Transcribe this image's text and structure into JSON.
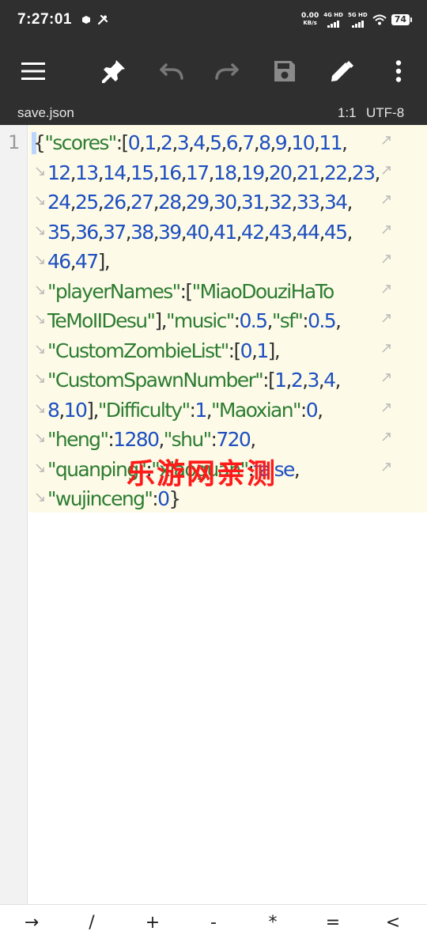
{
  "status": {
    "time": "7:27:01",
    "net_speed_value": "0.00",
    "net_speed_unit": "KB/s",
    "sim1_label": "4G HD",
    "sim2_label": "5G HD",
    "battery": "74"
  },
  "toolbar": {
    "icons": [
      "menu-icon",
      "pin-icon",
      "undo-icon",
      "redo-icon",
      "save-icon",
      "edit-icon",
      "more-icon"
    ]
  },
  "info": {
    "filename": "save.json",
    "cursor_position": "1:1",
    "encoding": "UTF-8"
  },
  "editor": {
    "line_number": "1",
    "lines": [
      [
        {
          "t": "{",
          "c": "p"
        },
        {
          "t": "\"scores\"",
          "c": "k"
        },
        {
          "t": ":[",
          "c": "p"
        },
        {
          "t": "0",
          "c": "n"
        },
        {
          "t": ",",
          "c": "p"
        },
        {
          "t": "1",
          "c": "n"
        },
        {
          "t": ",",
          "c": "p"
        },
        {
          "t": "2",
          "c": "n"
        },
        {
          "t": ",",
          "c": "p"
        },
        {
          "t": "3",
          "c": "n"
        },
        {
          "t": ",",
          "c": "p"
        },
        {
          "t": "4",
          "c": "n"
        },
        {
          "t": ",",
          "c": "p"
        },
        {
          "t": "5",
          "c": "n"
        },
        {
          "t": ",",
          "c": "p"
        },
        {
          "t": "6",
          "c": "n"
        },
        {
          "t": ",",
          "c": "p"
        },
        {
          "t": "7",
          "c": "n"
        },
        {
          "t": ",",
          "c": "p"
        },
        {
          "t": "8",
          "c": "n"
        },
        {
          "t": ",",
          "c": "p"
        },
        {
          "t": "9",
          "c": "n"
        },
        {
          "t": ",",
          "c": "p"
        },
        {
          "t": "10",
          "c": "n"
        },
        {
          "t": ",",
          "c": "p"
        },
        {
          "t": "11",
          "c": "n"
        },
        {
          "t": ",",
          "c": "p"
        }
      ],
      [
        {
          "t": "12",
          "c": "n"
        },
        {
          "t": ",",
          "c": "p"
        },
        {
          "t": "13",
          "c": "n"
        },
        {
          "t": ",",
          "c": "p"
        },
        {
          "t": "14",
          "c": "n"
        },
        {
          "t": ",",
          "c": "p"
        },
        {
          "t": "15",
          "c": "n"
        },
        {
          "t": ",",
          "c": "p"
        },
        {
          "t": "16",
          "c": "n"
        },
        {
          "t": ",",
          "c": "p"
        },
        {
          "t": "17",
          "c": "n"
        },
        {
          "t": ",",
          "c": "p"
        },
        {
          "t": "18",
          "c": "n"
        },
        {
          "t": ",",
          "c": "p"
        },
        {
          "t": "19",
          "c": "n"
        },
        {
          "t": ",",
          "c": "p"
        },
        {
          "t": "20",
          "c": "n"
        },
        {
          "t": ",",
          "c": "p"
        },
        {
          "t": "21",
          "c": "n"
        },
        {
          "t": ",",
          "c": "p"
        },
        {
          "t": "22",
          "c": "n"
        },
        {
          "t": ",",
          "c": "p"
        },
        {
          "t": "23",
          "c": "n"
        },
        {
          "t": ",",
          "c": "p"
        }
      ],
      [
        {
          "t": "24",
          "c": "n"
        },
        {
          "t": ",",
          "c": "p"
        },
        {
          "t": "25",
          "c": "n"
        },
        {
          "t": ",",
          "c": "p"
        },
        {
          "t": "26",
          "c": "n"
        },
        {
          "t": ",",
          "c": "p"
        },
        {
          "t": "27",
          "c": "n"
        },
        {
          "t": ",",
          "c": "p"
        },
        {
          "t": "28",
          "c": "n"
        },
        {
          "t": ",",
          "c": "p"
        },
        {
          "t": "29",
          "c": "n"
        },
        {
          "t": ",",
          "c": "p"
        },
        {
          "t": "30",
          "c": "n"
        },
        {
          "t": ",",
          "c": "p"
        },
        {
          "t": "31",
          "c": "n"
        },
        {
          "t": ",",
          "c": "p"
        },
        {
          "t": "32",
          "c": "n"
        },
        {
          "t": ",",
          "c": "p"
        },
        {
          "t": "33",
          "c": "n"
        },
        {
          "t": ",",
          "c": "p"
        },
        {
          "t": "34",
          "c": "n"
        },
        {
          "t": ",",
          "c": "p"
        }
      ],
      [
        {
          "t": "35",
          "c": "n"
        },
        {
          "t": ",",
          "c": "p"
        },
        {
          "t": "36",
          "c": "n"
        },
        {
          "t": ",",
          "c": "p"
        },
        {
          "t": "37",
          "c": "n"
        },
        {
          "t": ",",
          "c": "p"
        },
        {
          "t": "38",
          "c": "n"
        },
        {
          "t": ",",
          "c": "p"
        },
        {
          "t": "39",
          "c": "n"
        },
        {
          "t": ",",
          "c": "p"
        },
        {
          "t": "40",
          "c": "n"
        },
        {
          "t": ",",
          "c": "p"
        },
        {
          "t": "41",
          "c": "n"
        },
        {
          "t": ",",
          "c": "p"
        },
        {
          "t": "42",
          "c": "n"
        },
        {
          "t": ",",
          "c": "p"
        },
        {
          "t": "43",
          "c": "n"
        },
        {
          "t": ",",
          "c": "p"
        },
        {
          "t": "44",
          "c": "n"
        },
        {
          "t": ",",
          "c": "p"
        },
        {
          "t": "45",
          "c": "n"
        },
        {
          "t": ",",
          "c": "p"
        }
      ],
      [
        {
          "t": "46",
          "c": "n"
        },
        {
          "t": ",",
          "c": "p"
        },
        {
          "t": "47",
          "c": "n"
        },
        {
          "t": "],",
          "c": "p"
        }
      ],
      [
        {
          "t": "\"playerNames\"",
          "c": "k"
        },
        {
          "t": ":[",
          "c": "p"
        },
        {
          "t": "\"MiaoDouziHaTo",
          "c": "k"
        }
      ],
      [
        {
          "t": "TeMoIIDesu\"",
          "c": "k"
        },
        {
          "t": "],",
          "c": "p"
        },
        {
          "t": "\"music\"",
          "c": "k"
        },
        {
          "t": ":",
          "c": "p"
        },
        {
          "t": "0.5",
          "c": "n"
        },
        {
          "t": ",",
          "c": "p"
        },
        {
          "t": "\"sf\"",
          "c": "k"
        },
        {
          "t": ":",
          "c": "p"
        },
        {
          "t": "0.5",
          "c": "n"
        },
        {
          "t": ",",
          "c": "p"
        }
      ],
      [
        {
          "t": "\"CustomZombieList\"",
          "c": "k"
        },
        {
          "t": ":[",
          "c": "p"
        },
        {
          "t": "0",
          "c": "n"
        },
        {
          "t": ",",
          "c": "p"
        },
        {
          "t": "1",
          "c": "n"
        },
        {
          "t": "],",
          "c": "p"
        }
      ],
      [
        {
          "t": "\"CustomSpawnNumber\"",
          "c": "k"
        },
        {
          "t": ":[",
          "c": "p"
        },
        {
          "t": "1",
          "c": "n"
        },
        {
          "t": ",",
          "c": "p"
        },
        {
          "t": "2",
          "c": "n"
        },
        {
          "t": ",",
          "c": "p"
        },
        {
          "t": "3",
          "c": "n"
        },
        {
          "t": ",",
          "c": "p"
        },
        {
          "t": "4",
          "c": "n"
        },
        {
          "t": ",",
          "c": "p"
        }
      ],
      [
        {
          "t": "8",
          "c": "n"
        },
        {
          "t": ",",
          "c": "p"
        },
        {
          "t": "10",
          "c": "n"
        },
        {
          "t": "],",
          "c": "p"
        },
        {
          "t": "\"Difficulty\"",
          "c": "k"
        },
        {
          "t": ":",
          "c": "p"
        },
        {
          "t": "1",
          "c": "n"
        },
        {
          "t": ",",
          "c": "p"
        },
        {
          "t": "\"Maoxian\"",
          "c": "k"
        },
        {
          "t": ":",
          "c": "p"
        },
        {
          "t": "0",
          "c": "n"
        },
        {
          "t": ",",
          "c": "p"
        }
      ],
      [
        {
          "t": "\"heng\"",
          "c": "k"
        },
        {
          "t": ":",
          "c": "p"
        },
        {
          "t": "1280",
          "c": "n"
        },
        {
          "t": ",",
          "c": "p"
        },
        {
          "t": "\"shu\"",
          "c": "k"
        },
        {
          "t": ":",
          "c": "p"
        },
        {
          "t": "720",
          "c": "n"
        },
        {
          "t": ",",
          "c": "p"
        }
      ],
      [
        {
          "t": "\"quanping\"",
          "c": "k"
        },
        {
          "t": ":",
          "c": "p"
        },
        {
          "t": "\"xiaoguan\"",
          "c": "k"
        },
        {
          "t": ":",
          "c": "p"
        },
        {
          "t": "false",
          "c": "n"
        },
        {
          "t": ",",
          "c": "p"
        }
      ],
      [
        {
          "t": "\"wujinceng\"",
          "c": "k"
        },
        {
          "t": ":",
          "c": "p"
        },
        {
          "t": "0",
          "c": "n"
        },
        {
          "t": "}",
          "c": "p"
        }
      ]
    ]
  },
  "watermark": "乐游网亲测",
  "keys": [
    "→",
    "/",
    "+",
    "-",
    "*",
    "=",
    "<"
  ],
  "colors": {
    "bar": "#2f2f2f",
    "code_bg": "#fdfbe8",
    "key": "#2e7d32",
    "value": "#1e4fc0",
    "watermark": "#ff1a1a"
  }
}
